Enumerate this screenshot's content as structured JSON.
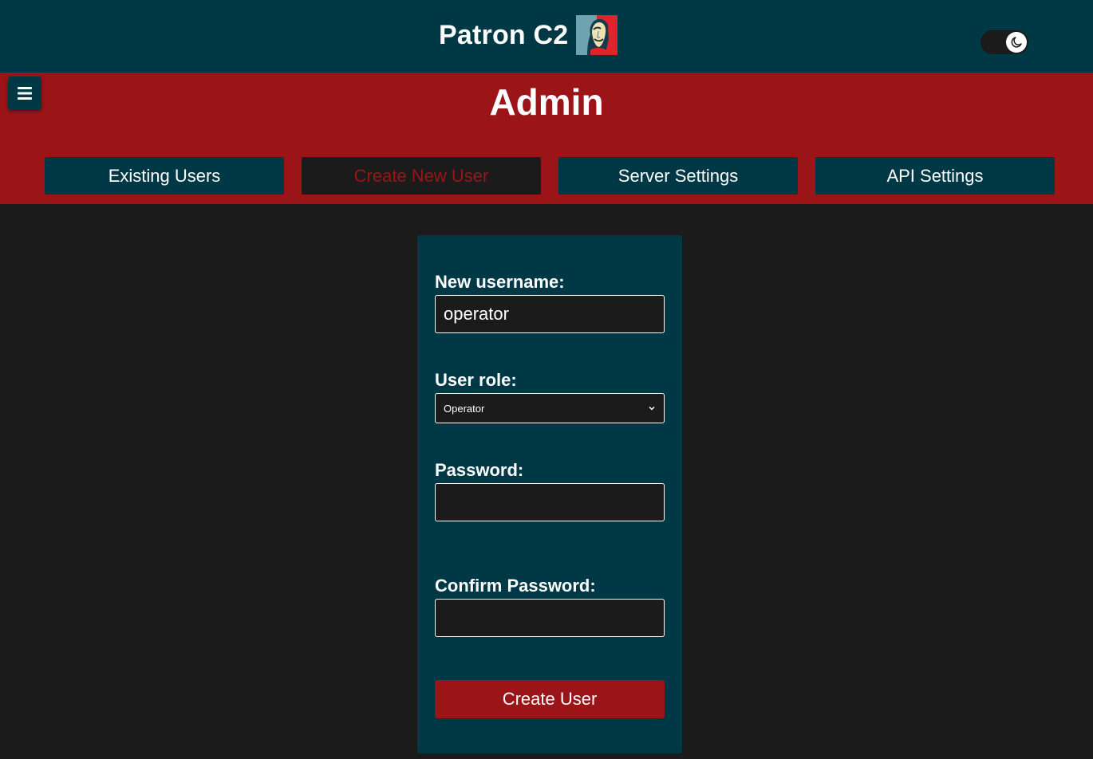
{
  "header": {
    "app_title": "Patron C2",
    "logo_icon": "portrait-logo-icon",
    "theme_toggle_icon": "moon-icon"
  },
  "admin": {
    "menu_icon": "hamburger-menu-icon",
    "title": "Admin",
    "tabs": [
      {
        "label": "Existing Users",
        "active": false
      },
      {
        "label": "Create New User",
        "active": true
      },
      {
        "label": "Server Settings",
        "active": false
      },
      {
        "label": "API Settings",
        "active": false
      }
    ]
  },
  "form": {
    "username_label": "New username:",
    "username_value": "operator",
    "role_label": "User role:",
    "role_selected": "Operator",
    "password_label": "Password:",
    "password_value": "",
    "confirm_label": "Confirm Password:",
    "confirm_value": "",
    "submit_label": "Create User"
  },
  "colors": {
    "header_bg": "#003845",
    "accent_red": "#9b1518",
    "page_bg": "#1b1b1b",
    "text": "#ffffff"
  }
}
